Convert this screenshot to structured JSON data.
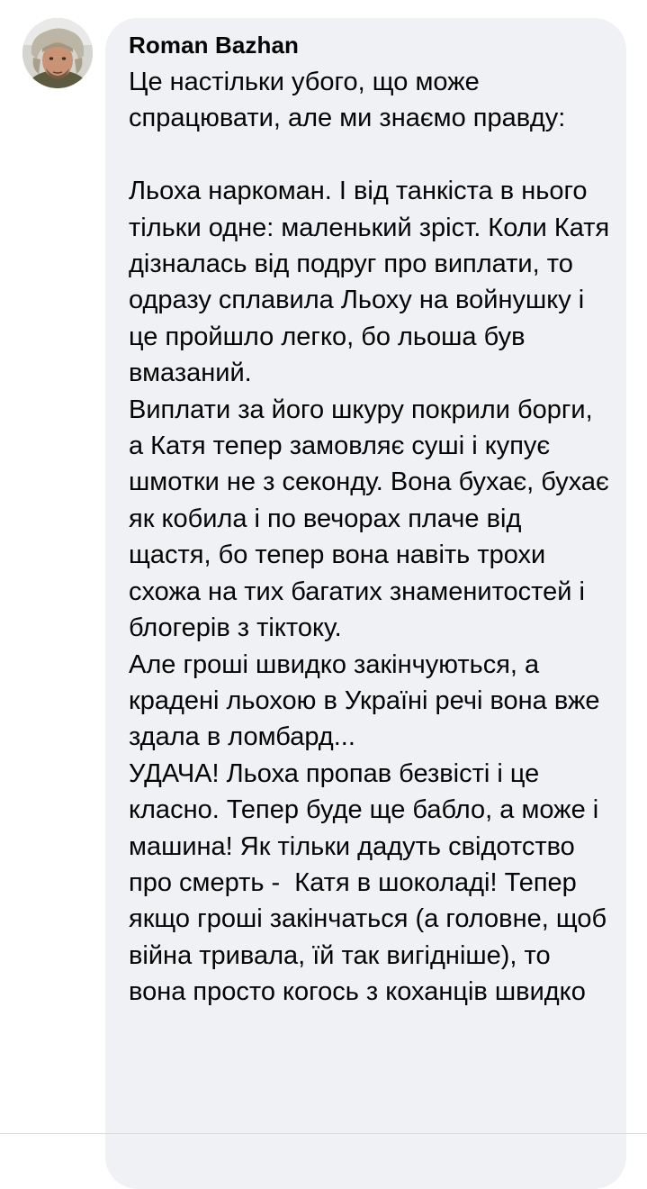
{
  "comment": {
    "author": "Roman  Bazhan",
    "text": "Це настільки убого, що може спрацювати, але ми знаємо правду:\n\nЛьоха наркоман. І від танкіста в нього тільки одне: маленький зріст. Коли Катя дізналась від подруг про виплати, то одразу сплавила Льоху на войнушку і це пройшло легко, бо льоша був вмазаний.\nВиплати за його шкуру покрили борги, а Катя тепер замовляє суші і купує шмотки не з секонду. Вона бухає, бухає як кобила і по вечорах плаче від щастя, бо тепер вона навіть трохи схожа на тих багатих знаменитостей і блогерів з тіктоку.\nАле гроші швидко закінчуються, а крадені льохою в Україні речі вона вже здала в ломбард...\nУДАЧА! Льоха пропав безвісті і це класно. Тепер буде ще бабло, а може і машина! Як тільки дадуть свідотство про смерть -  Катя в шоколаді! Тепер якщо гроші закінчаться (а головне, щоб війна тривала, їй так вигідніше), то вона просто когось з коханців швидко"
  },
  "colors": {
    "bubble": "#eff1f4",
    "text": "#050505"
  }
}
